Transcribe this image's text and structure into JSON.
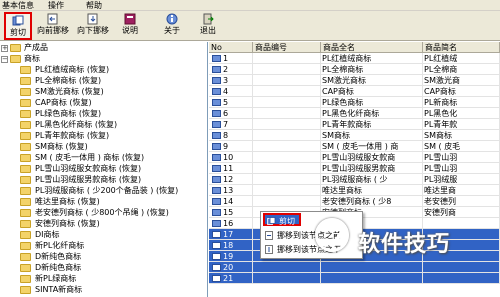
{
  "menubar": {
    "items": [
      "基本信息",
      "操作",
      "帮助"
    ]
  },
  "toolbar": {
    "buttons": [
      {
        "label": "剪切",
        "icon": "cut-icon"
      },
      {
        "label": "向前挪移",
        "icon": "move-forward-icon"
      },
      {
        "label": "向下挪移",
        "icon": "move-down-icon"
      },
      {
        "label": "说明",
        "icon": "help-book-icon"
      },
      {
        "label": "关于",
        "icon": "about-icon"
      },
      {
        "label": "退出",
        "icon": "exit-icon"
      }
    ]
  },
  "tree": {
    "items": [
      "产成品",
      "商标",
      "PL红植绒商标 (恢复)",
      "PL全棉商标 (恢复)",
      "SM激光商标 (恢复)",
      "CAP商标 (恢复)",
      "PL绿色商标 (恢复)",
      "PL黑色化纤商标 (恢复)",
      "PL青年款商标 (恢复)",
      "SM商标 (恢复)",
      "SM ( 皮毛一体用 ) 商标 (恢复)",
      "PL雪山羽绒服女款商标 (恢复)",
      "PL雪山羽绒服男款商标 (恢复)",
      "PL羽绒服商标 ( 少200个备品装 ) (恢复)",
      "唯达里商标 (恢复)",
      "老安德列商标 ( 少800个吊绳 ) (恢复)",
      "安德列商标 (恢复)",
      "DI商标",
      "新PL化纤商标",
      "D新纯色商标",
      "D新纯色商标",
      "新PL绿商标",
      "SINTA新商标"
    ]
  },
  "grid": {
    "columns": [
      "No",
      "商品编号",
      "商品全名",
      "商品简名"
    ],
    "rows": [
      {
        "no": "1",
        "code": "",
        "name": "PL红植绒商标",
        "short": "PL红植绒"
      },
      {
        "no": "2",
        "code": "",
        "name": "PL全棉商标",
        "short": "PL全棉商"
      },
      {
        "no": "3",
        "code": "",
        "name": "SM激光商标",
        "short": "SM激光商"
      },
      {
        "no": "4",
        "code": "",
        "name": "CAP商标",
        "short": "CAP商标"
      },
      {
        "no": "5",
        "code": "",
        "name": "PL绿色商标",
        "short": "PL新商标"
      },
      {
        "no": "6",
        "code": "",
        "name": "PL黑色化纤商标",
        "short": "PL黑色化"
      },
      {
        "no": "7",
        "code": "",
        "name": "PL青年款商标",
        "short": "PL青年款"
      },
      {
        "no": "8",
        "code": "",
        "name": "SM商标",
        "short": "SM商标"
      },
      {
        "no": "9",
        "code": "",
        "name": "SM ( 皮毛一体用 ) 商",
        "short": "SM ( 皮毛"
      },
      {
        "no": "10",
        "code": "",
        "name": "PL雪山羽绒服女款商",
        "short": "PL雪山羽"
      },
      {
        "no": "11",
        "code": "",
        "name": "PL雪山羽绒服男款商",
        "short": "PL雪山羽"
      },
      {
        "no": "12",
        "code": "",
        "name": "PL羽绒服商标 ( 少",
        "short": "PL羽绒服"
      },
      {
        "no": "13",
        "code": "",
        "name": "唯达里商标",
        "short": "唯达里商"
      },
      {
        "no": "14",
        "code": "",
        "name": "老安德列商标 ( 少8",
        "short": "老安德列"
      },
      {
        "no": "15",
        "code": "",
        "name": "安德列商标",
        "short": "安德列商"
      },
      {
        "no": "16",
        "code": "",
        "name": "DI商标",
        "short": ""
      },
      {
        "no": "17",
        "code": "",
        "name": "",
        "short": ""
      },
      {
        "no": "18",
        "code": "",
        "name": "",
        "short": ""
      },
      {
        "no": "19",
        "code": "",
        "name": "",
        "short": ""
      },
      {
        "no": "20",
        "code": "",
        "name": "",
        "short": ""
      },
      {
        "no": "21",
        "code": "",
        "name": "",
        "short": ""
      }
    ]
  },
  "context_menu": {
    "items": [
      "剪切",
      "挪移到该节点之前",
      "挪移到该节点之下"
    ]
  },
  "watermark": {
    "text": "软件技巧"
  },
  "colors": {
    "selection": "#3163c5",
    "highlight_border": "#e00000",
    "chrome": "#ece9d8"
  }
}
